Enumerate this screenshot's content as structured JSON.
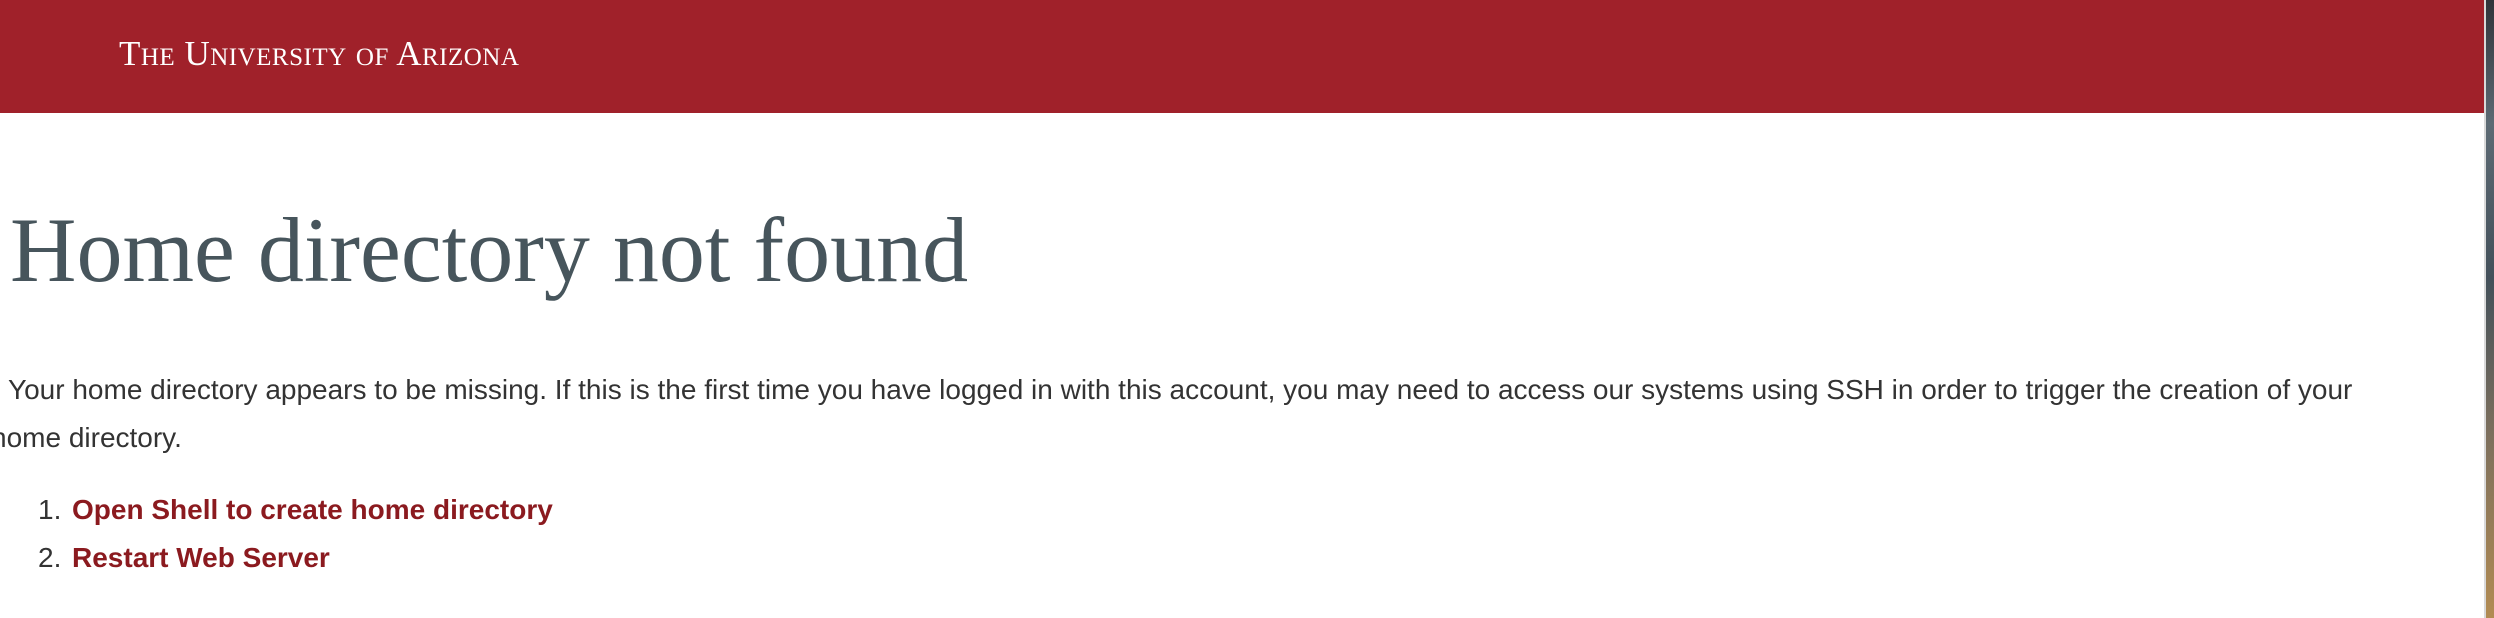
{
  "header": {
    "brand": "The University of Arizona"
  },
  "main": {
    "title": "Home directory not found",
    "message": {
      "line1": "Your home directory appears to be missing. If this is the first time you have logged in with this account, you may need to access our systems using SSH in order to trigger the creation of your",
      "line2": "home directory."
    },
    "actions": [
      {
        "number": "1.",
        "label": "Open Shell to create home directory"
      },
      {
        "number": "2.",
        "label": "Restart Web Server"
      }
    ]
  },
  "colors": {
    "brand_red": "#a0212a",
    "link_red": "#8b1a1f",
    "title_gray": "#47555c",
    "body_text": "#333333"
  }
}
